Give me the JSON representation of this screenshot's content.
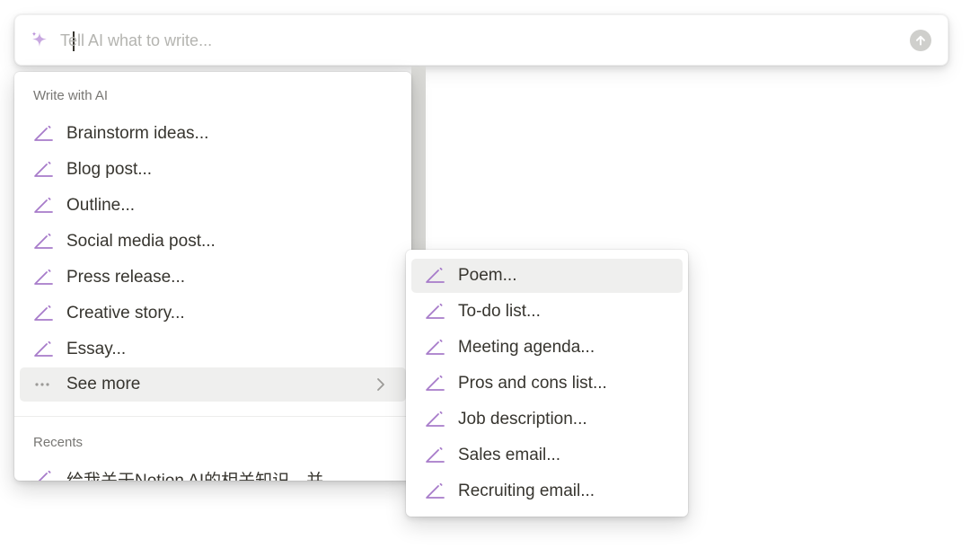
{
  "prompt": {
    "placeholder": "Tell AI what to write...",
    "value": "",
    "icons": {
      "leading": "sparkle-icon",
      "submit": "arrow-up-circle-icon"
    },
    "accent_color": "#a77bca"
  },
  "main_menu": {
    "section_write": "Write with AI",
    "items": [
      {
        "label": "Brainstorm ideas...",
        "icon": "pencil-icon"
      },
      {
        "label": "Blog post...",
        "icon": "pencil-icon"
      },
      {
        "label": "Outline...",
        "icon": "pencil-icon"
      },
      {
        "label": "Social media post...",
        "icon": "pencil-icon"
      },
      {
        "label": "Press release...",
        "icon": "pencil-icon"
      },
      {
        "label": "Creative story...",
        "icon": "pencil-icon"
      },
      {
        "label": "Essay...",
        "icon": "pencil-icon"
      }
    ],
    "see_more": {
      "label": "See more",
      "icon": "ellipsis-icon",
      "trailing_icon": "chevron-right-icon"
    },
    "section_recents": "Recents",
    "recents": [
      {
        "label": "给我关于Notion AI的相关知识，并",
        "icon": "pencil-icon"
      }
    ]
  },
  "sub_menu": {
    "items": [
      {
        "label": "Poem...",
        "icon": "pencil-icon"
      },
      {
        "label": "To-do list...",
        "icon": "pencil-icon"
      },
      {
        "label": "Meeting agenda...",
        "icon": "pencil-icon"
      },
      {
        "label": "Pros and cons list...",
        "icon": "pencil-icon"
      },
      {
        "label": "Job description...",
        "icon": "pencil-icon"
      },
      {
        "label": "Sales email...",
        "icon": "pencil-icon"
      },
      {
        "label": "Recruiting email...",
        "icon": "pencil-icon"
      }
    ]
  }
}
